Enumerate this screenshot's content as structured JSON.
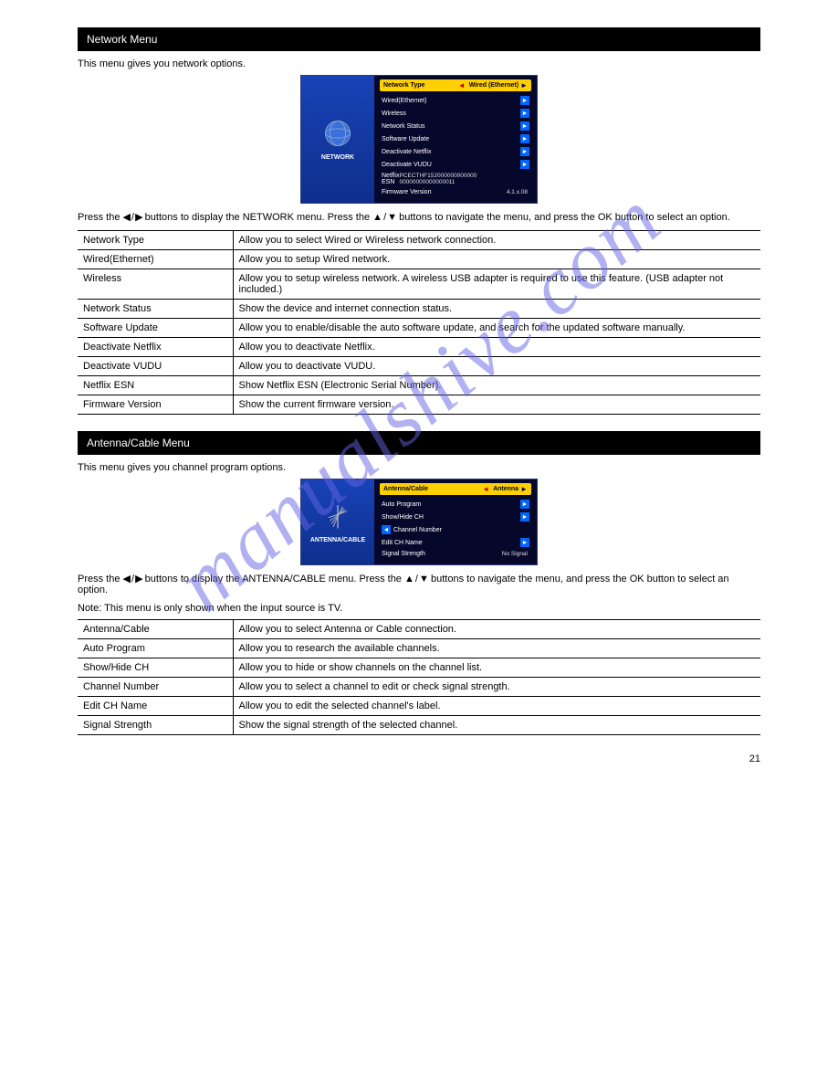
{
  "watermark": "manualshive.com",
  "sections": [
    {
      "header": "Network Menu",
      "intro": "This menu gives you network options.",
      "menu": {
        "sideLabel": "NETWORK",
        "iconType": "globe",
        "titleLeft": "Network Type",
        "titleLeftArrow": "◄",
        "titleVal": "Wired (Ethernet)",
        "titleRightArrow": "►",
        "items": [
          {
            "label": "Wired(Ethernet)",
            "val": "",
            "arrow": "►",
            "pos": "right"
          },
          {
            "label": "Wireless",
            "val": "",
            "arrow": "►",
            "pos": "right"
          },
          {
            "label": "Network Status",
            "val": "",
            "arrow": "►",
            "pos": "right"
          },
          {
            "label": "Software Update",
            "val": "",
            "arrow": "►",
            "pos": "right"
          },
          {
            "label": "Deactivate Netflix",
            "val": "",
            "arrow": "►",
            "pos": "right"
          },
          {
            "label": "Deactivate VUDU",
            "val": "",
            "arrow": "►",
            "pos": "right"
          },
          {
            "label": "Netflix ESN",
            "val": "PCECTHF152000000000000\n00000000000000011",
            "arrow": "",
            "pos": "none"
          },
          {
            "label": "Firmware Version",
            "val": "4.1.x.08",
            "arrow": "",
            "pos": "none"
          }
        ]
      },
      "nav": {
        "pre": "Press the ",
        "mid1": " buttons to display the NETWORK menu. Press the ",
        "mid2": " buttons to navigate the menu, and press the OK button to select an option."
      },
      "rows": [
        {
          "k": "Network Type",
          "v": "Allow you to select Wired or Wireless network connection."
        },
        {
          "k": "Wired(Ethernet)",
          "v": "Allow you to setup Wired network."
        },
        {
          "k": "Wireless",
          "v": "Allow you to setup wireless network. A wireless USB adapter is required to use this feature. (USB adapter not included.)"
        },
        {
          "k": "Network Status",
          "v": "Show the device and internet connection status."
        },
        {
          "k": "Software Update",
          "v": "Allow you to enable/disable the auto software update, and search for the updated software manually."
        },
        {
          "k": "Deactivate Netflix",
          "v": "Allow you to deactivate Netflix."
        },
        {
          "k": "Deactivate VUDU",
          "v": "Allow you to deactivate VUDU."
        },
        {
          "k": "Netflix ESN",
          "v": "Show Netflix ESN (Electronic Serial Number)."
        },
        {
          "k": "Firmware Version",
          "v": "Show the current firmware version."
        }
      ]
    },
    {
      "header": "Antenna/Cable Menu",
      "intro": "This menu gives you channel program options.",
      "menu": {
        "sideLabel": "ANTENNA/CABLE",
        "iconType": "antenna",
        "titleLeft": "Antenna/Cable",
        "titleLeftArrow": "◄",
        "titleVal": "Antenna",
        "titleRightArrow": "►",
        "items": [
          {
            "label": "Auto Program",
            "val": "",
            "arrow": "►",
            "pos": "right"
          },
          {
            "label": "Show/Hide CH",
            "val": "",
            "arrow": "►",
            "pos": "right"
          },
          {
            "label": "Channel Number",
            "val": "",
            "arrow": "◄",
            "pos": "left"
          },
          {
            "label": "Edit CH Name",
            "val": "",
            "arrow": "►",
            "pos": "right"
          },
          {
            "label": "Signal Strength",
            "val": "No Signal",
            "arrow": "",
            "pos": "none"
          }
        ]
      },
      "nav": {
        "pre": "Press the ",
        "mid1": " buttons to display the ANTENNA/CABLE menu. Press the ",
        "mid2": " buttons to navigate the menu, and press the OK button to select an option."
      },
      "note": "Note: This menu is only shown when the input source is TV.",
      "rows": [
        {
          "k": "Antenna/Cable",
          "v": "Allow you to select Antenna or Cable connection."
        },
        {
          "k": "Auto Program",
          "v": "Allow you to research the available channels."
        },
        {
          "k": "Show/Hide CH",
          "v": "Allow you to hide or show channels on the channel list."
        },
        {
          "k": "Channel Number",
          "v": "Allow you to select a channel to edit or check signal strength."
        },
        {
          "k": "Edit CH Name",
          "v": "Allow you to edit the selected channel's label."
        },
        {
          "k": "Signal Strength",
          "v": "Show the signal strength of the selected channel."
        }
      ]
    }
  ],
  "footer": "21"
}
